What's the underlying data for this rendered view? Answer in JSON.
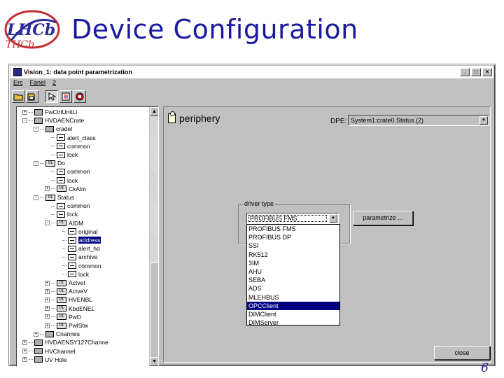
{
  "slide": {
    "logo_text": "LHCb",
    "title": "Device Configuration",
    "page_number": "6"
  },
  "window": {
    "title": "Vision_1: data point parametrization",
    "buttons": {
      "minimize": "_",
      "maximize": "□",
      "close": "×"
    },
    "menu": [
      "Erc",
      "Fanel",
      "2"
    ],
    "toolbar_icons": [
      "open-folder-icon",
      "save-icon",
      "pointer-icon",
      "list-icon",
      "chip-icon"
    ]
  },
  "tree": {
    "items": [
      {
        "label": "FwCtrlUnitLi",
        "depth": 1,
        "toggle": "+",
        "icon": "dp"
      },
      {
        "label": "HVDAENCrate",
        "depth": 1,
        "toggle": "-",
        "icon": "dp"
      },
      {
        "label": "cradel",
        "depth": 2,
        "toggle": "-",
        "icon": "dp"
      },
      {
        "label": "alert_class",
        "depth": 3,
        "toggle": "",
        "icon": "leaf"
      },
      {
        "label": "common",
        "depth": 3,
        "toggle": "",
        "icon": "leaf"
      },
      {
        "label": "lock",
        "depth": 3,
        "toggle": "",
        "icon": "leaf"
      },
      {
        "label": "Do",
        "depth": 2,
        "toggle": "-",
        "icon": "bits"
      },
      {
        "label": "common",
        "depth": 3,
        "toggle": "",
        "icon": "leaf"
      },
      {
        "label": "lock",
        "depth": 3,
        "toggle": "",
        "icon": "leaf"
      },
      {
        "label": "CkAlm",
        "depth": 3,
        "toggle": "+",
        "icon": "bits"
      },
      {
        "label": "Status",
        "depth": 2,
        "toggle": "-",
        "icon": "bits"
      },
      {
        "label": "common",
        "depth": 3,
        "toggle": "",
        "icon": "leaf"
      },
      {
        "label": "lock",
        "depth": 3,
        "toggle": "",
        "icon": "leaf"
      },
      {
        "label": "AIDM",
        "depth": 3,
        "toggle": "-",
        "icon": "bits"
      },
      {
        "label": "original",
        "depth": 4,
        "toggle": "",
        "icon": "leaf"
      },
      {
        "label": "address",
        "depth": 4,
        "toggle": "",
        "icon": "leaf",
        "selected": true
      },
      {
        "label": "alert_hd",
        "depth": 4,
        "toggle": "",
        "icon": "leaf"
      },
      {
        "label": "archive",
        "depth": 4,
        "toggle": "",
        "icon": "leaf"
      },
      {
        "label": "common",
        "depth": 4,
        "toggle": "",
        "icon": "leaf"
      },
      {
        "label": "lock",
        "depth": 4,
        "toggle": "",
        "icon": "leaf"
      },
      {
        "label": "ActveI",
        "depth": 3,
        "toggle": "+",
        "icon": "bits"
      },
      {
        "label": "ActveV",
        "depth": 3,
        "toggle": "+",
        "icon": "bits"
      },
      {
        "label": "HVENBL",
        "depth": 3,
        "toggle": "+",
        "icon": "bits"
      },
      {
        "label": "KbdENEL",
        "depth": 3,
        "toggle": "+",
        "icon": "bits"
      },
      {
        "label": "PwD",
        "depth": 3,
        "toggle": "+",
        "icon": "bits"
      },
      {
        "label": "PwlStw",
        "depth": 3,
        "toggle": "+",
        "icon": "bits"
      },
      {
        "label": "Cnannes",
        "depth": 2,
        "toggle": "+",
        "icon": "dp"
      },
      {
        "label": "HVDAENSY127Channe",
        "depth": 1,
        "toggle": "+",
        "icon": "dp"
      },
      {
        "label": "HVChannel",
        "depth": 1,
        "toggle": "+",
        "icon": "dp"
      },
      {
        "label": "UV Hole",
        "depth": 1,
        "toggle": "+",
        "icon": "dp"
      }
    ],
    "scroll_up": "▲",
    "scroll_down": "▼"
  },
  "panel": {
    "periphery_label": "periphery",
    "dpe_label": "DPE:",
    "dpe_value": "System1:crate0.Status.(2)",
    "driver_group_label": "driver type",
    "driver_selected": "PROFIBUS FMS",
    "dropdown_arrow": "▼",
    "driver_options": [
      "PROFIBUS FMS",
      "PROFIBUS DP",
      "SSI",
      "RK512",
      "3IM",
      "AHU",
      "SEBA",
      "ADS",
      "MLEHBUS",
      "OPCClient",
      "DIMClient",
      "DIMServer"
    ],
    "highlighted_option": "OPCClient",
    "parametrize_button": "parametrize ...",
    "close_button": "close"
  },
  "colors": {
    "title": "#1a1aa0",
    "window_bg": "#c0c0c0",
    "selection": "#000080"
  }
}
